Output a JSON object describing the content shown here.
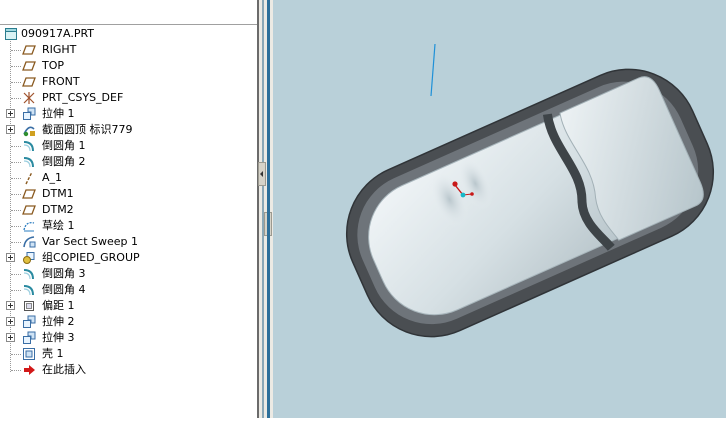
{
  "model_tree": {
    "root": "090917A.PRT",
    "items": [
      {
        "label": "RIGHT",
        "icon": "datum-plane-icon",
        "expandable": false
      },
      {
        "label": "TOP",
        "icon": "datum-plane-icon",
        "expandable": false
      },
      {
        "label": "FRONT",
        "icon": "datum-plane-icon",
        "expandable": false
      },
      {
        "label": "PRT_CSYS_DEF",
        "icon": "csys-icon",
        "expandable": false
      },
      {
        "label": "拉伸 1",
        "icon": "extrude-icon",
        "expandable": true
      },
      {
        "label": "截面圆顶 标识779",
        "icon": "section-dome-icon",
        "expandable": true
      },
      {
        "label": "倒圆角 1",
        "icon": "round-icon",
        "expandable": false
      },
      {
        "label": "倒圆角 2",
        "icon": "round-icon",
        "expandable": false
      },
      {
        "label": "A_1",
        "icon": "datum-axis-icon",
        "expandable": false
      },
      {
        "label": "DTM1",
        "icon": "datum-plane-icon",
        "expandable": false
      },
      {
        "label": "DTM2",
        "icon": "datum-plane-icon",
        "expandable": false
      },
      {
        "label": "草绘 1",
        "icon": "sketch-icon",
        "expandable": false
      },
      {
        "label": "Var Sect Sweep 1",
        "icon": "sweep-icon",
        "expandable": false
      },
      {
        "label": "组COPIED_GROUP",
        "icon": "group-icon",
        "expandable": true
      },
      {
        "label": "倒圆角 3",
        "icon": "round-icon",
        "expandable": false
      },
      {
        "label": "倒圆角 4",
        "icon": "round-icon",
        "expandable": false
      },
      {
        "label": "偏距 1",
        "icon": "offset-icon",
        "expandable": true
      },
      {
        "label": "拉伸 2",
        "icon": "extrude-icon",
        "expandable": true
      },
      {
        "label": "拉伸 3",
        "icon": "extrude-icon",
        "expandable": true
      },
      {
        "label": "壳 1",
        "icon": "shell-icon",
        "expandable": false
      },
      {
        "label": "在此插入",
        "icon": "insert-here-icon",
        "expandable": false
      }
    ]
  },
  "colors": {
    "viewport_bg": "#b9d0d9",
    "part_shell": "#4a4e52",
    "part_face": "#d9e2e6",
    "datum_axis": "#1e90d8",
    "insert_arrow": "#d21818"
  }
}
